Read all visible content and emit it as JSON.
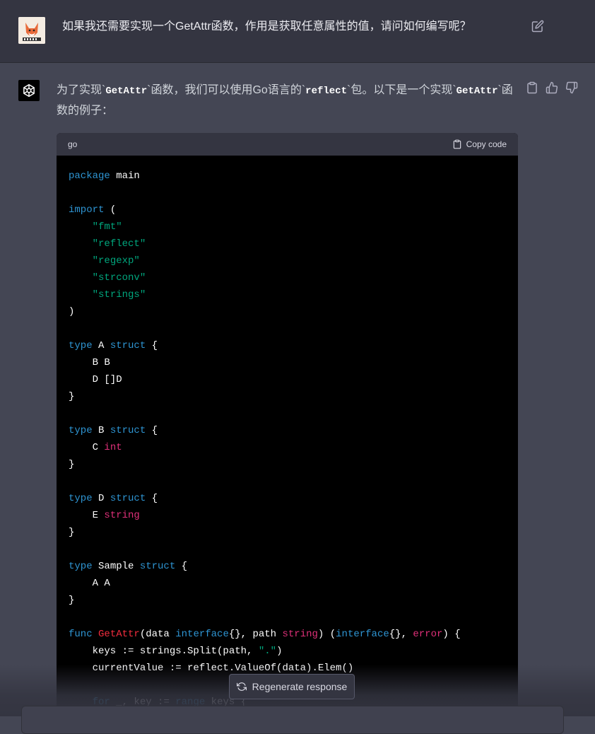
{
  "user": {
    "message": "如果我还需要实现一个GetAttr函数，作用是获取任意属性的值，请问如何编写呢？"
  },
  "assistant": {
    "intro_1": "为了实现`",
    "intro_code_1": "GetAttr",
    "intro_2": "`函数，我们可以使用Go语言的`",
    "intro_code_2": "reflect",
    "intro_3": "`包。以下是一个实现`",
    "intro_code_3": "GetAttr",
    "intro_4": "`函数的例子："
  },
  "code_block": {
    "language": "go",
    "copy_label": "Copy code"
  },
  "code_lines": [
    [
      {
        "t": "package",
        "c": "kw"
      },
      {
        "t": " main"
      }
    ],
    [],
    [
      {
        "t": "import",
        "c": "kw"
      },
      {
        "t": " ("
      }
    ],
    [
      {
        "t": "    "
      },
      {
        "t": "\"fmt\"",
        "c": "str"
      }
    ],
    [
      {
        "t": "    "
      },
      {
        "t": "\"reflect\"",
        "c": "str"
      }
    ],
    [
      {
        "t": "    "
      },
      {
        "t": "\"regexp\"",
        "c": "str"
      }
    ],
    [
      {
        "t": "    "
      },
      {
        "t": "\"strconv\"",
        "c": "str"
      }
    ],
    [
      {
        "t": "    "
      },
      {
        "t": "\"strings\"",
        "c": "str"
      }
    ],
    [
      {
        "t": ")"
      }
    ],
    [],
    [
      {
        "t": "type",
        "c": "kw"
      },
      {
        "t": " A "
      },
      {
        "t": "struct",
        "c": "kw"
      },
      {
        "t": " {"
      }
    ],
    [
      {
        "t": "    B B"
      }
    ],
    [
      {
        "t": "    D []D"
      }
    ],
    [
      {
        "t": "}"
      }
    ],
    [],
    [
      {
        "t": "type",
        "c": "kw"
      },
      {
        "t": " B "
      },
      {
        "t": "struct",
        "c": "kw"
      },
      {
        "t": " {"
      }
    ],
    [
      {
        "t": "    C "
      },
      {
        "t": "int",
        "c": "typ"
      }
    ],
    [
      {
        "t": "}"
      }
    ],
    [],
    [
      {
        "t": "type",
        "c": "kw"
      },
      {
        "t": " D "
      },
      {
        "t": "struct",
        "c": "kw"
      },
      {
        "t": " {"
      }
    ],
    [
      {
        "t": "    E "
      },
      {
        "t": "string",
        "c": "typ"
      }
    ],
    [
      {
        "t": "}"
      }
    ],
    [],
    [
      {
        "t": "type",
        "c": "kw"
      },
      {
        "t": " Sample "
      },
      {
        "t": "struct",
        "c": "kw"
      },
      {
        "t": " {"
      }
    ],
    [
      {
        "t": "    A A"
      }
    ],
    [
      {
        "t": "}"
      }
    ],
    [],
    [
      {
        "t": "func",
        "c": "kw"
      },
      {
        "t": " "
      },
      {
        "t": "GetAttr",
        "c": "fn"
      },
      {
        "t": "(data "
      },
      {
        "t": "interface",
        "c": "kw"
      },
      {
        "t": "{}, path "
      },
      {
        "t": "string",
        "c": "typ"
      },
      {
        "t": ") ("
      },
      {
        "t": "interface",
        "c": "kw"
      },
      {
        "t": "{}, "
      },
      {
        "t": "error",
        "c": "typ"
      },
      {
        "t": ") {"
      }
    ],
    [
      {
        "t": "    keys := strings.Split(path, "
      },
      {
        "t": "\".\"",
        "c": "str"
      },
      {
        "t": ")"
      }
    ],
    [
      {
        "t": "    currentValue := reflect.ValueOf(data).Elem()"
      }
    ],
    [],
    [
      {
        "t": "    "
      },
      {
        "t": "for",
        "c": "kw"
      },
      {
        "t": " _, key := "
      },
      {
        "t": "range",
        "c": "kw"
      },
      {
        "t": " keys {"
      }
    ]
  ],
  "regenerate_label": "Regenerate response",
  "icons": {
    "edit": "edit-icon",
    "copy": "clipboard-icon",
    "thumbs_up": "thumbs-up-icon",
    "thumbs_down": "thumbs-down-icon",
    "regenerate": "refresh-icon"
  },
  "colors": {
    "background": "#444654",
    "user_row": "#343541",
    "code_bg": "#000000",
    "keyword": "#2e95d3",
    "string": "#00a67d",
    "type": "#df3079",
    "function": "#f22c3d"
  }
}
